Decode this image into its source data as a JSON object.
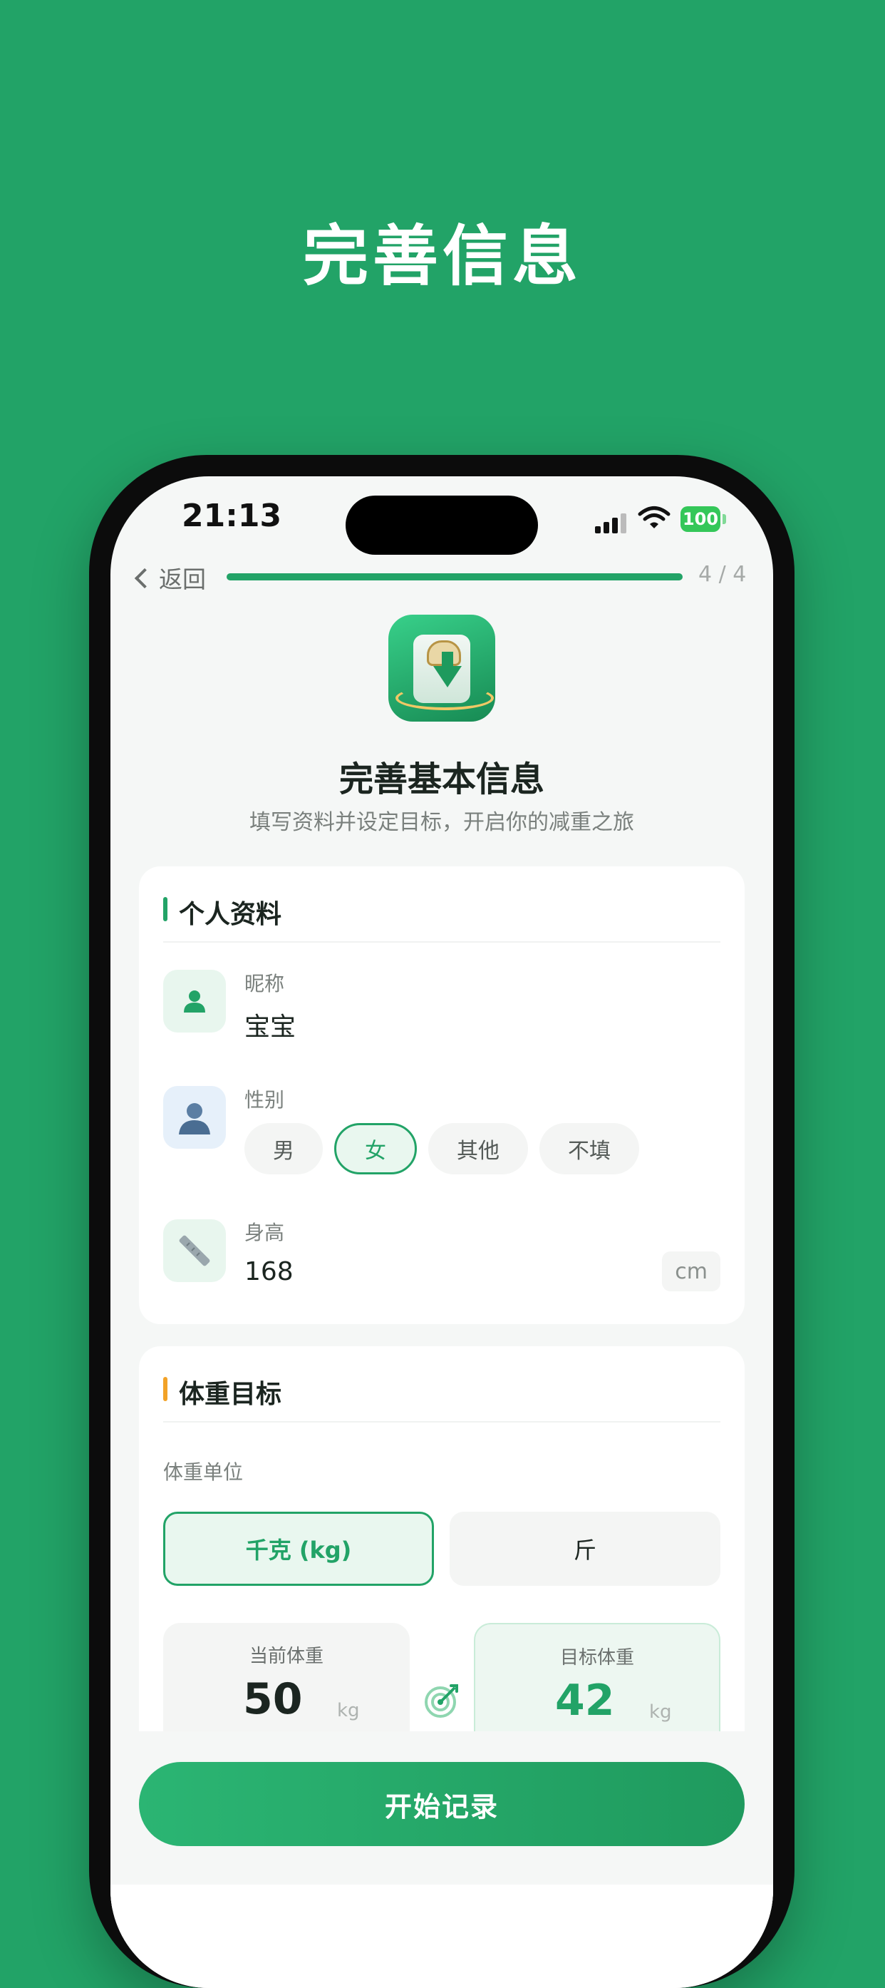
{
  "promo": {
    "title": "完善信息"
  },
  "status_bar": {
    "time": "21:13",
    "battery": "100"
  },
  "nav": {
    "back_label": "返回",
    "progress_text": "4 / 4",
    "progress_fraction": 1.0
  },
  "header": {
    "title": "完善基本信息",
    "subtitle": "填写资料并设定目标，开启你的减重之旅"
  },
  "personal": {
    "title": "个人资料",
    "nickname_label": "昵称",
    "nickname_value": "宝宝",
    "gender_label": "性别",
    "gender_options": [
      "男",
      "女",
      "其他",
      "不填"
    ],
    "gender_selected": "女",
    "height_label": "身高",
    "height_value": "168",
    "height_unit": "cm"
  },
  "weight_goal": {
    "title": "体重目标",
    "unit_label": "体重单位",
    "unit_options": [
      "千克 (kg)",
      "斤"
    ],
    "unit_selected": "千克 (kg)",
    "current_label": "当前体重",
    "current_value": "50",
    "current_unit": "kg",
    "target_label": "目标体重",
    "target_value": "42",
    "target_unit": "kg"
  },
  "actions": {
    "start_label": "开始记录"
  },
  "colors": {
    "brand_green": "#22a367",
    "accent_orange": "#f2a227"
  }
}
